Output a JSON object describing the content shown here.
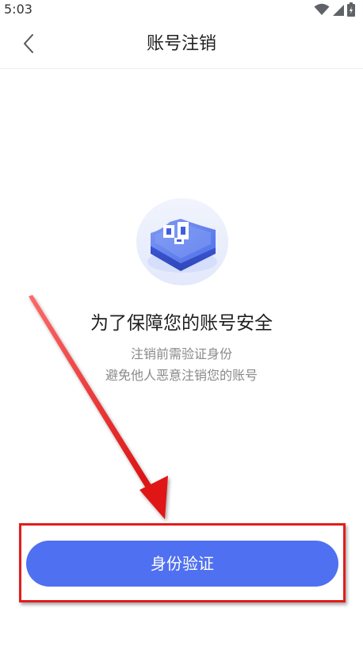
{
  "status_bar": {
    "time": "5:03",
    "icons": [
      "wifi-icon",
      "cellular-signal-icon",
      "battery-icon"
    ]
  },
  "nav": {
    "back_icon": "chevron-left-icon",
    "title": "账号注销"
  },
  "content": {
    "illustration": "shield-security-illustration",
    "headline": "为了保障您的账号安全",
    "line1": "注销前需验证身份",
    "line2": "避免他人恶意注销您的账号"
  },
  "action": {
    "button_label": "身份验证"
  },
  "colors": {
    "accent": "#4f70f0",
    "annotation_red": "#e21d1d"
  }
}
